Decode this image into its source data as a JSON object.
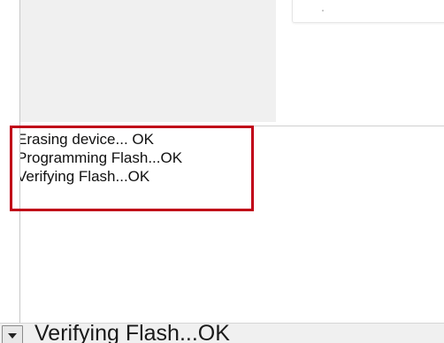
{
  "output": {
    "lines": [
      "Erasing device... OK",
      "Programming Flash...OK",
      "Verifying Flash...OK"
    ]
  },
  "status": {
    "current_message": "Verifying Flash...OK"
  },
  "icons": {
    "dropdown": "chevron-down-icon"
  },
  "colors": {
    "highlight": "#c00018",
    "panel_gray": "#f0f0f0"
  }
}
